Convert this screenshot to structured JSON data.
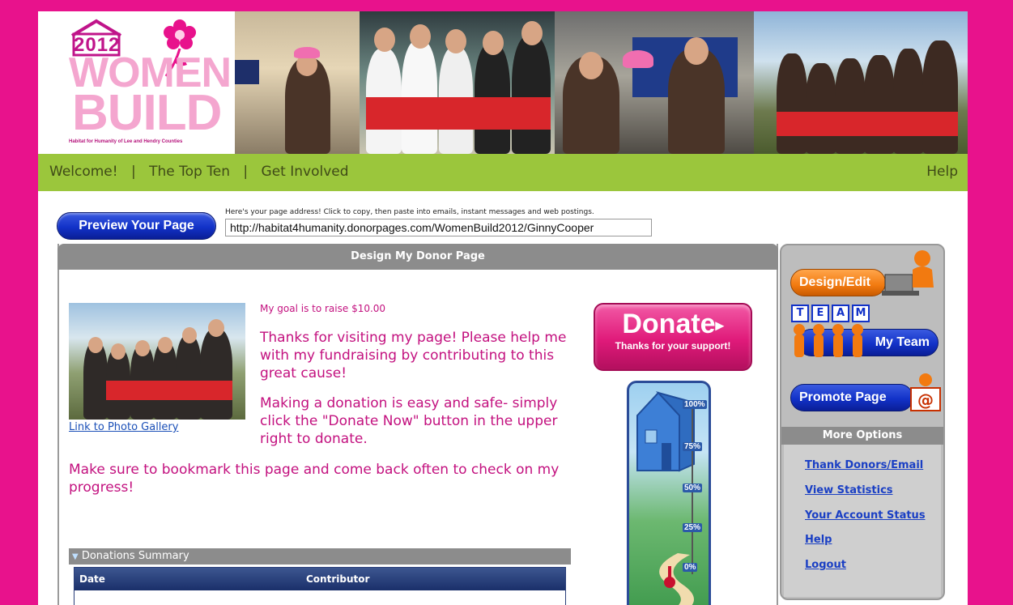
{
  "banner": {
    "logo_year": "2012",
    "logo_word1": "WOMEN",
    "logo_word2": "BUILD",
    "logo_tagline": "Habitat for Humanity of Lee and Hendry Counties"
  },
  "nav": {
    "items": [
      "Welcome!",
      "The Top Ten",
      "Get Involved"
    ],
    "separator": "|",
    "help": "Help"
  },
  "address": {
    "preview_label": "Preview Your Page",
    "hint": "Here's your page address! Click to copy, then paste into emails, instant messages and web postings.",
    "url": "http://habitat4humanity.donorpages.com/WomenBuild2012/GinnyCooper"
  },
  "main": {
    "title": "Design My Donor Page",
    "gallery_link": "Link to Photo Gallery",
    "goal": "My goal is to raise $10.00",
    "message1": "Thanks for visiting my page! Please help me with my fundraising by contributing to this great cause!",
    "message2": "Making a donation is easy and safe- simply click the \"Donate Now\" button in the upper right to donate.",
    "message3": "Make sure to bookmark this page and come back often to check on my progress!",
    "donate": {
      "label": "Donate",
      "arrow": "▸",
      "sub": "Thanks for your support!"
    },
    "thermometer": {
      "marks": [
        "100%",
        "75%",
        "50%",
        "25%",
        "0%"
      ],
      "progress": 0
    },
    "donations_summary": {
      "title": "Donations Summary",
      "columns": [
        "Date",
        "Contributor"
      ],
      "rows": []
    }
  },
  "side": {
    "design_edit": "Design/Edit",
    "team_letters": [
      "T",
      "E",
      "A",
      "M"
    ],
    "my_team": "My Team",
    "promote": "Promote Page",
    "more_options": "More Options",
    "options": [
      "Thank Donors/Email",
      "View Statistics",
      "Your Account Status",
      "Help",
      "Logout"
    ]
  },
  "colors": {
    "frame": "#e8128c",
    "nav": "#9bc63c",
    "brand_pink": "#c3117f",
    "button_blue": "#1232c8",
    "button_orange": "#f27a10"
  }
}
